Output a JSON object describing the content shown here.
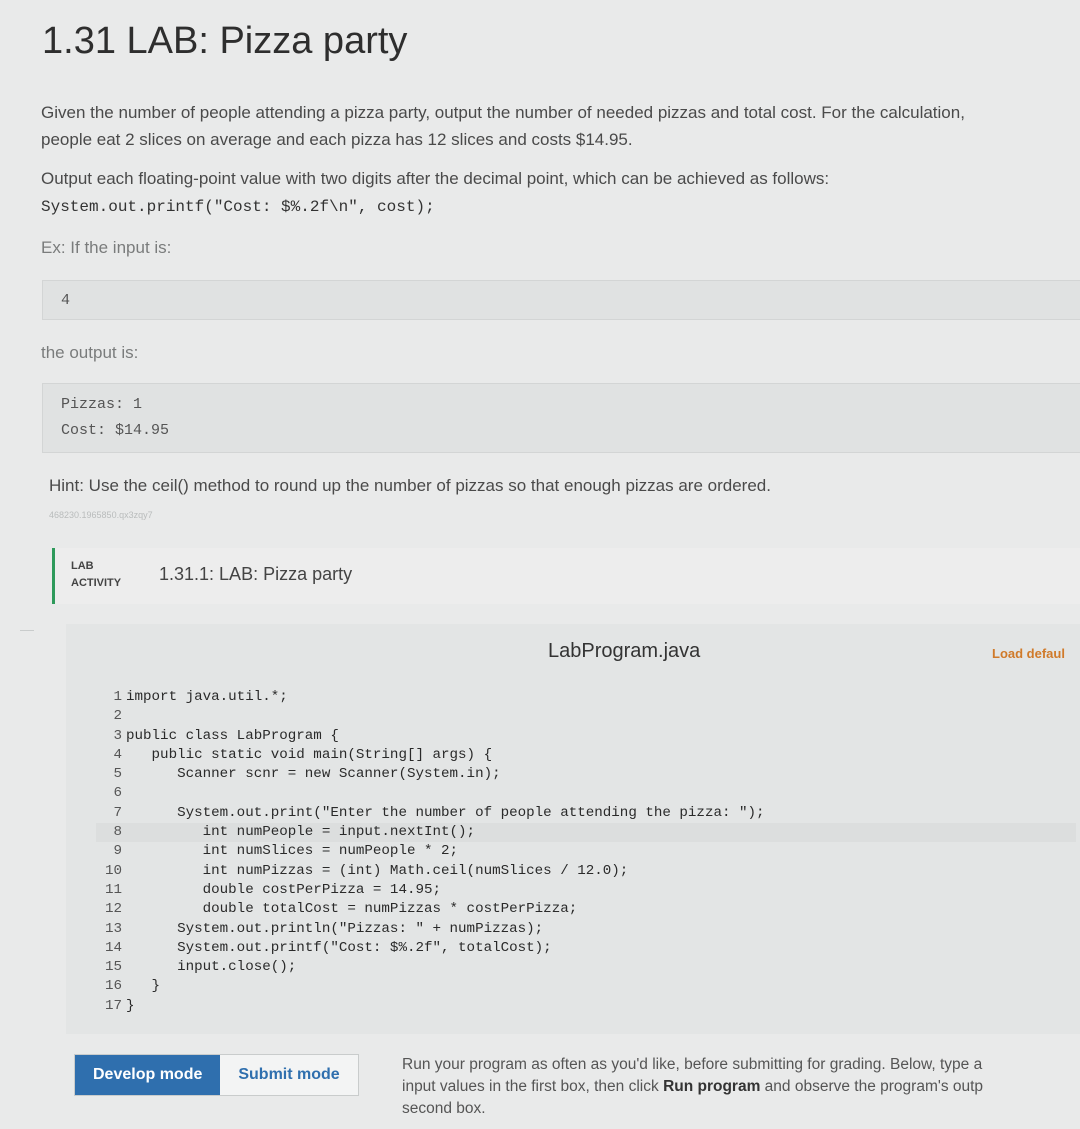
{
  "title": "1.31 LAB: Pizza party",
  "description": {
    "line1": "Given the number of people attending a pizza party, output the number of needed pizzas and total cost. For the calculation,",
    "line2": "people eat 2 slices on average and each pizza has 12 slices and costs $14.95.",
    "line3": "Output each floating-point value with two digits after the decimal point, which can be achieved as follows:",
    "code": "System.out.printf(\"Cost: $%.2f\\n\", cost);",
    "example_label": "Ex: If the input is:",
    "example_input": "4",
    "output_label": "the output is:",
    "output_lines": [
      "Pizzas: 1",
      "Cost: $14.95"
    ],
    "hint": "Hint: Use the ceil() method to round up the number of pizzas so that enough pizzas are ordered.",
    "tracking_id": "468230.1965850.qx3zqy7"
  },
  "lab": {
    "tag_line1": "LAB",
    "tag_line2": "ACTIVITY",
    "name": "1.31.1: LAB: Pizza party"
  },
  "editor": {
    "filename": "LabProgram.java",
    "load_default": "Load defaul",
    "lines": [
      {
        "n": "1",
        "code": "import java.util.*;"
      },
      {
        "n": "2",
        "code": ""
      },
      {
        "n": "3",
        "code": "public class LabProgram {"
      },
      {
        "n": "4",
        "code": "   public static void main(String[] args) {"
      },
      {
        "n": "5",
        "code": "      Scanner scnr = new Scanner(System.in);"
      },
      {
        "n": "6",
        "code": ""
      },
      {
        "n": "7",
        "code": "      System.out.print(\"Enter the number of people attending the pizza: \");"
      },
      {
        "n": "8",
        "code": "         int numPeople = input.nextInt();"
      },
      {
        "n": "9",
        "code": "         int numSlices = numPeople * 2;"
      },
      {
        "n": "10",
        "code": "         int numPizzas = (int) Math.ceil(numSlices / 12.0);"
      },
      {
        "n": "11",
        "code": "         double costPerPizza = 14.95;"
      },
      {
        "n": "12",
        "code": "         double totalCost = numPizzas * costPerPizza;"
      },
      {
        "n": "13",
        "code": "      System.out.println(\"Pizzas: \" + numPizzas);"
      },
      {
        "n": "14",
        "code": "      System.out.printf(\"Cost: $%.2f\", totalCost);"
      },
      {
        "n": "15",
        "code": "      input.close();"
      },
      {
        "n": "16",
        "code": "   }"
      },
      {
        "n": "17",
        "code": "}"
      }
    ]
  },
  "modes": {
    "develop": "Develop mode",
    "submit": "Submit mode"
  },
  "instructions": {
    "part1": "Run your program as often as you'd like, before submitting for grading. Below, type a",
    "part2a": "input values in the first box, then click ",
    "run_label": "Run program",
    "part2b": " and observe the program's outp",
    "part3": "second box."
  }
}
